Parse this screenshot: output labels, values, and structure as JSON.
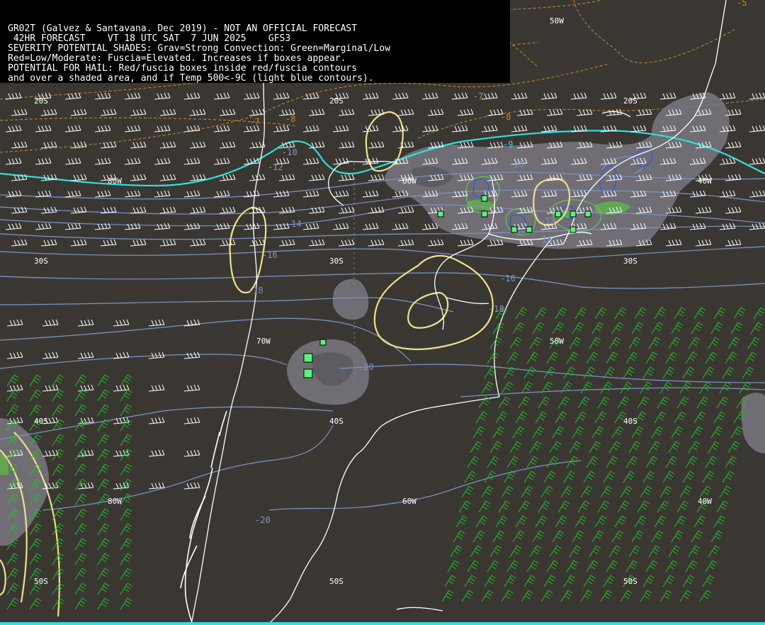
{
  "header": {
    "line1": "GR02T (Galvez & Santavana. Dec 2019) - NOT AN OFFICIAL FORECAST",
    "line2": " 42HR FORECAST    VT 18 UTC SAT  7 JUN 2025    GFS3",
    "line3": "SEVERITY POTENTIAL SHADES: Grav=Strong Convection: Green=Marginal/Low",
    "line4": "Red=Low/Moderate: Fuscia=Elevated. Increases if boxes appear.",
    "line5": "POTENTIAL FOR HAIL: Red/fuscia boxes inside red/fuscia contours",
    "line6": "and over a shaded area, and if Temp 500<-9C (light blue contours)."
  },
  "grid_labels": {
    "lat_20s": "20S",
    "lat_30s": "30S",
    "lat_40s": "40S",
    "lat_50s": "50S",
    "lon_80w": "80W",
    "lon_70w": "70W",
    "lon_60w": "60W",
    "lon_50w": "50W",
    "lon_40w": "40W"
  },
  "contour_labels": {
    "t_m5": "-5",
    "t_m7": "-7",
    "t_m8": "-8",
    "t_m9": "-9",
    "t_m10": "-10",
    "t_m12": "-12",
    "t_m14": "-14",
    "t_m16": "-16",
    "t_m18": "-18",
    "t_m20": "-20"
  },
  "colors": {
    "background": "#3a3733",
    "coastline": "#ffffff",
    "temp_contour": "#7d93c8",
    "minus9_contour": "#2ee0e0",
    "dashed_contour": "#c98a2a",
    "severity_gray": "#7a7880",
    "severity_green": "#5fb04a",
    "severity_yellow": "#efe08a",
    "hail_box": "#5ef07a",
    "wind_barbs_white": "#ffffff",
    "wind_barbs_green": "#22c322"
  }
}
